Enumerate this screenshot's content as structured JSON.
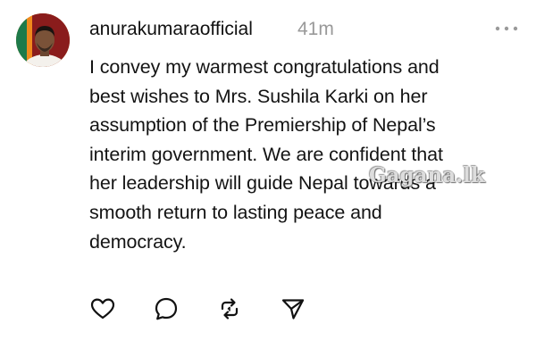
{
  "post": {
    "username": "anurakumaraofficial",
    "timestamp": "41m",
    "body_lines": [
      "I convey my warmest congratulations and",
      "best wishes to Mrs. Sushila Karki on her",
      "assumption of the Premiership of Nepal’s",
      "interim government. We are confident that",
      "her leadership will guide Nepal towards a",
      "smooth return to lasting peace and",
      "democracy."
    ],
    "body_text": "I convey my warmest congratulations and\nbest wishes to Mrs. Sushila Karki on her\nassumption of the Premiership of Nepal’s\ninterim government. We are confident that\nher leadership will guide Nepal towards a\nsmooth return to lasting peace and\ndemocracy.",
    "watermark": "Gagana.lk"
  },
  "actions": {
    "like": {
      "icon": "heart-icon"
    },
    "reply": {
      "icon": "comment-icon"
    },
    "repost": {
      "icon": "repost-icon"
    },
    "share": {
      "icon": "send-icon"
    }
  },
  "more_menu": {
    "icon": "more-horizontal-icon"
  },
  "colors": {
    "text": "#141414",
    "secondary": "#999999",
    "icon": "#111111"
  }
}
